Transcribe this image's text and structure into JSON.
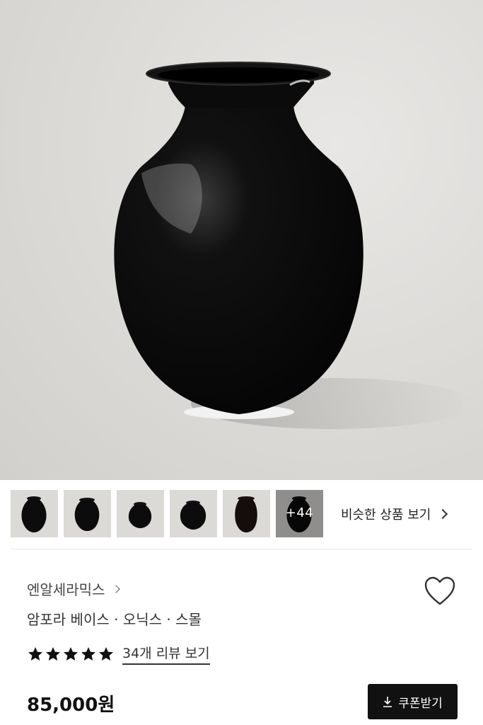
{
  "product": {
    "image_alt": "black glossy vase",
    "more_count": "+44",
    "similar_label": "비슷한 상품 보기",
    "brand": "엔알세라믹스",
    "title": "암포라 베이스 · 오닉스 · 스몰",
    "rating_stars": 5,
    "review_link": "34개 리뷰 보기",
    "price": "85,000원",
    "coupon_label": "쿠폰받기"
  },
  "colors": {
    "accent": "#111111",
    "background": "#ffffff",
    "divider": "#e6e6e6"
  }
}
